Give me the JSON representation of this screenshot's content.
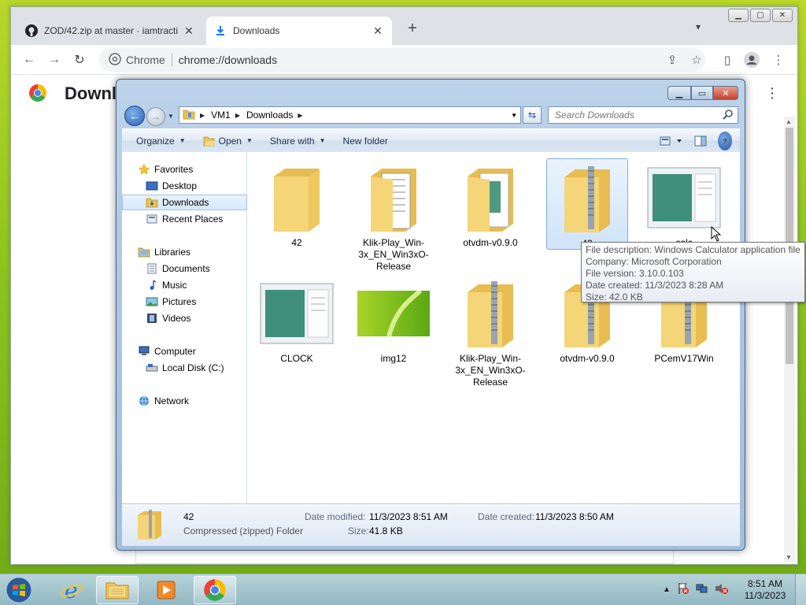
{
  "chrome": {
    "tabs": [
      {
        "title": "ZOD/42.zip at master · iamtracti",
        "icon": "github-icon",
        "close": "✕"
      },
      {
        "title": "Downloads",
        "icon": "download-icon",
        "close": "✕"
      }
    ],
    "newtab": "+",
    "omnibox": {
      "chip": "Chrome",
      "url": "chrome://downloads"
    },
    "page_title": "Downloads"
  },
  "explorer": {
    "breadcrumb": [
      "VM1",
      "Downloads"
    ],
    "search_placeholder": "Search Downloads",
    "commands": {
      "organize": "Organize",
      "open": "Open",
      "share": "Share with",
      "newfolder": "New folder"
    },
    "nav": {
      "favorites": "Favorites",
      "desktop": "Desktop",
      "downloads": "Downloads",
      "recent": "Recent Places",
      "libraries": "Libraries",
      "documents": "Documents",
      "music": "Music",
      "pictures": "Pictures",
      "videos": "Videos",
      "computer": "Computer",
      "localdisk": "Local Disk (C:)",
      "network": "Network"
    },
    "items": [
      {
        "name": "42",
        "kind": "folder"
      },
      {
        "name": "Klik-Play_Win-3x_EN_Win3xO-Release",
        "kind": "folder-docs"
      },
      {
        "name": "otvdm-v0.9.0",
        "kind": "folder-docs"
      },
      {
        "name": "42",
        "kind": "zip"
      },
      {
        "name": "calc",
        "kind": "app"
      },
      {
        "name": "CLOCK",
        "kind": "app"
      },
      {
        "name": "img12",
        "kind": "image"
      },
      {
        "name": "Klik-Play_Win-3x_EN_Win3xO-Release",
        "kind": "zip"
      },
      {
        "name": "otvdm-v0.9.0",
        "kind": "zip"
      },
      {
        "name": "PCemV17Win",
        "kind": "zip"
      }
    ],
    "tooltip": {
      "line1": "File description: Windows Calculator application file",
      "line2": "Company: Microsoft Corporation",
      "line3": "File version: 3.10.0.103",
      "line4": "Date created: 11/3/2023 8:28 AM",
      "line5": "Size: 42.0 KB"
    },
    "details": {
      "name": "42",
      "type": "Compressed (zipped) Folder",
      "modified_label": "Date modified:",
      "modified": "11/3/2023 8:51 AM",
      "created_label": "Date created:",
      "created": "11/3/2023 8:50 AM",
      "size_label": "Size:",
      "size": "41.8 KB"
    }
  },
  "taskbar": {
    "time": "8:51 AM",
    "date": "11/3/2023"
  },
  "colors": {
    "accent": "#3c78c8",
    "folder": "#f2cf6a",
    "selection": "#cfe4fa"
  }
}
